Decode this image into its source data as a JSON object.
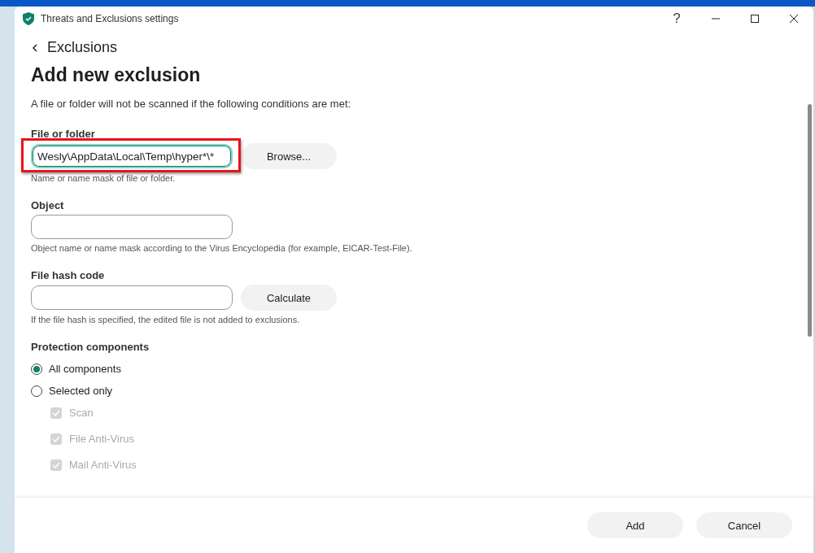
{
  "window": {
    "title": "Threats and Exclusions settings",
    "help": "?"
  },
  "back_link": "Exclusions",
  "heading": "Add new exclusion",
  "intro": "A file or folder will not be scanned if the following conditions are met:",
  "fields": [
    {
      "label": "File or folder",
      "value": "Wesly\\AppData\\Local\\Temp\\hyper*\\*",
      "focused": true,
      "highlighted": true,
      "button": "Browse...",
      "hint": "Name or name mask of file or folder."
    },
    {
      "label": "Object",
      "focused": false,
      "highlighted": false,
      "hint": "Object name or name mask according to the Virus Encyclopedia (for example, EICAR-Test-File)."
    },
    {
      "label": "File hash code",
      "focused": false,
      "highlighted": false,
      "button": "Calculate",
      "hint": "If the file hash is specified, the edited file is not added to exclusions."
    }
  ],
  "protection": {
    "label": "Protection components",
    "options": [
      {
        "label": "All components",
        "selected": true
      },
      {
        "label": "Selected only",
        "selected": false
      }
    ],
    "components": [
      {
        "label": "Scan",
        "checked": true,
        "disabled": true
      },
      {
        "label": "File Anti-Virus",
        "checked": true,
        "disabled": true
      },
      {
        "label": "Mail Anti-Virus",
        "checked": true,
        "disabled": true
      }
    ]
  },
  "buttons": [
    "Add",
    "Cancel"
  ]
}
